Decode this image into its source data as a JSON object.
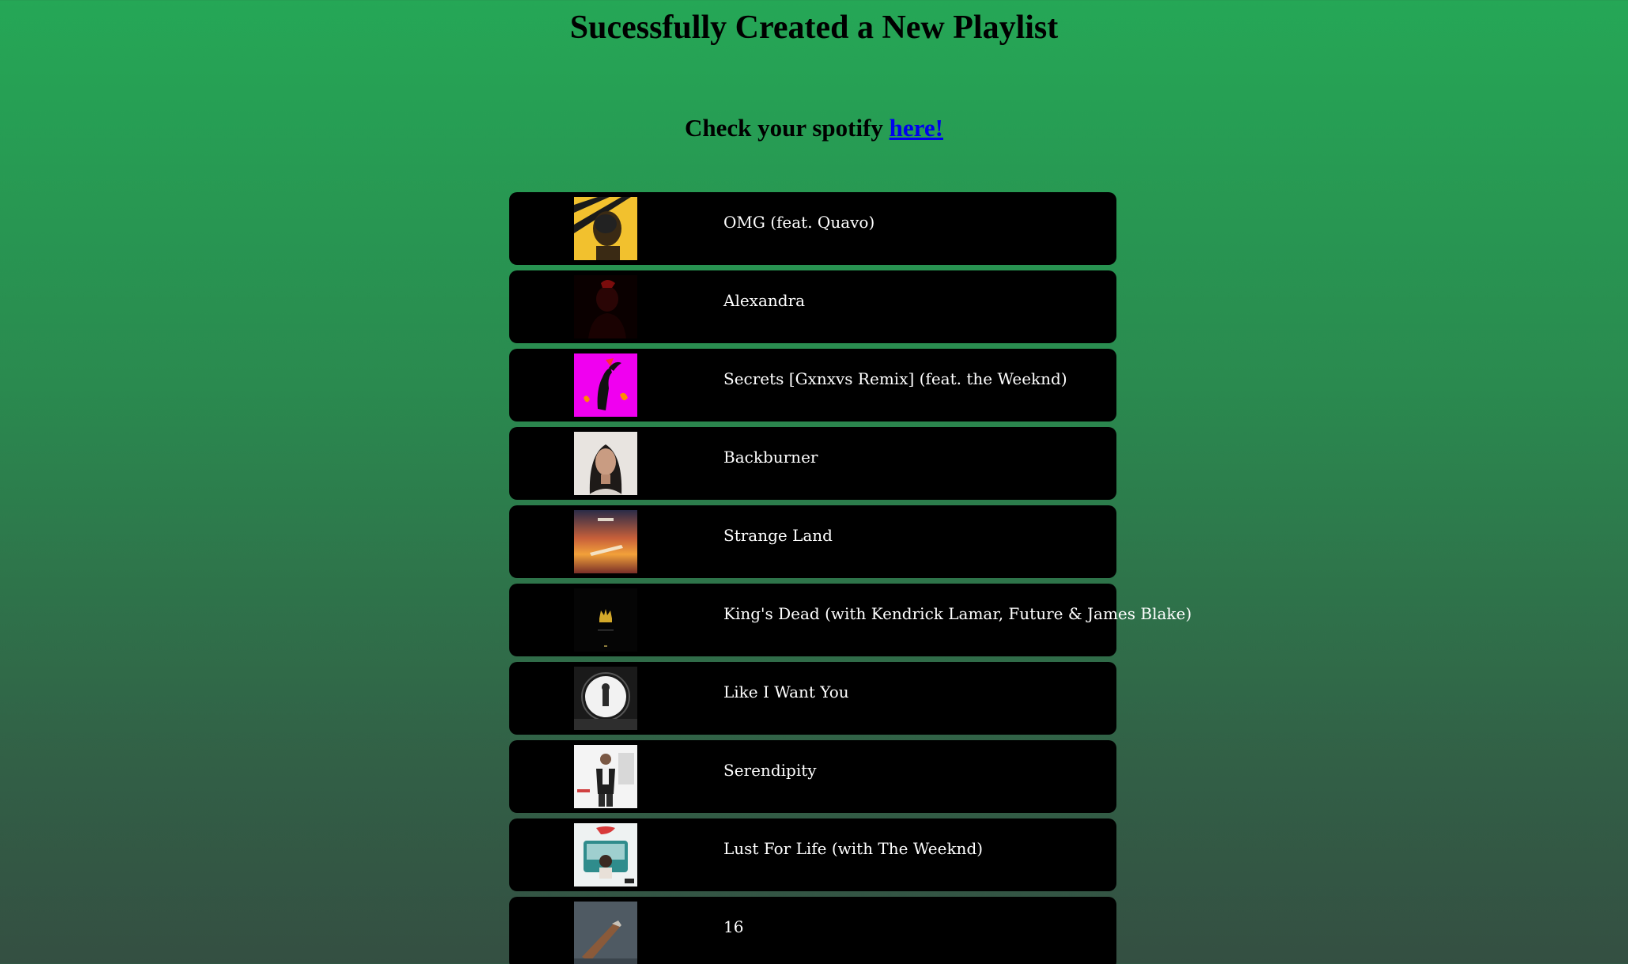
{
  "header": {
    "title": "Sucessfully Created a New Playlist",
    "check_text": "Check your spotify ",
    "link_text": "here!"
  },
  "tracks": [
    {
      "name": "OMG (feat. Quavo)",
      "cover_icon": "album-cover-omg"
    },
    {
      "name": "Alexandra",
      "cover_icon": "album-cover-alexandra"
    },
    {
      "name": "Secrets [Gxnxvs Remix] (feat. the Weeknd)",
      "cover_icon": "album-cover-secrets"
    },
    {
      "name": "Backburner",
      "cover_icon": "album-cover-backburner"
    },
    {
      "name": "Strange Land",
      "cover_icon": "album-cover-strange-land"
    },
    {
      "name": "King's Dead (with Kendrick Lamar, Future & James Blake)",
      "cover_icon": "album-cover-kings-dead"
    },
    {
      "name": "Like I Want You",
      "cover_icon": "album-cover-like-i-want-you"
    },
    {
      "name": "Serendipity",
      "cover_icon": "album-cover-serendipity"
    },
    {
      "name": "Lust For Life (with The Weeknd)",
      "cover_icon": "album-cover-lust-for-life"
    },
    {
      "name": "16",
      "cover_icon": "album-cover-16"
    }
  ],
  "colors": {
    "background_top": "#25a756",
    "background_bottom": "#344f42",
    "row_background": "#000000",
    "link": "#0000ee"
  }
}
